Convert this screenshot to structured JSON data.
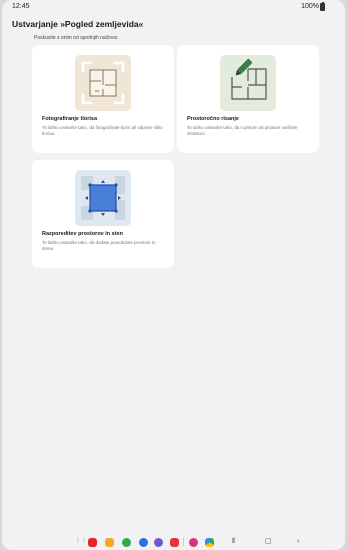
{
  "status_bar": {
    "time": "12:45",
    "battery": "100%"
  },
  "header": {
    "title": "Ustvarjanje »Pogled zemljevida«",
    "subtitle": "Poskusite z enim od spodnjih načinov."
  },
  "cards": [
    {
      "title": "Fotografiranje tlorisa",
      "description": "To lahko ustvarite tako, da fotografirate tloris ali odprete sliko tlorisa.",
      "icon": "camera-floorplan-icon"
    },
    {
      "title": "Prostoročno risanje",
      "description": "To lahko ustvarite tako, da s prstom ali pisalom narišete strukturo.",
      "icon": "pencil-floorplan-icon"
    },
    {
      "title": "Razporeditev prostorov in sten",
      "description": "To lahko ustvarite tako, da dodate pravokotne prostore in stene.",
      "icon": "room-layout-icon"
    }
  ],
  "navbar": {
    "apps": [
      "app-drawer-icon",
      "flipboard-icon",
      "my-files-icon",
      "phone-icon",
      "messages-icon",
      "browser-icon",
      "youtube-icon",
      "gallery-icon",
      "google-drive-icon"
    ],
    "buttons": [
      "recents-icon",
      "home-icon",
      "back-icon"
    ]
  }
}
